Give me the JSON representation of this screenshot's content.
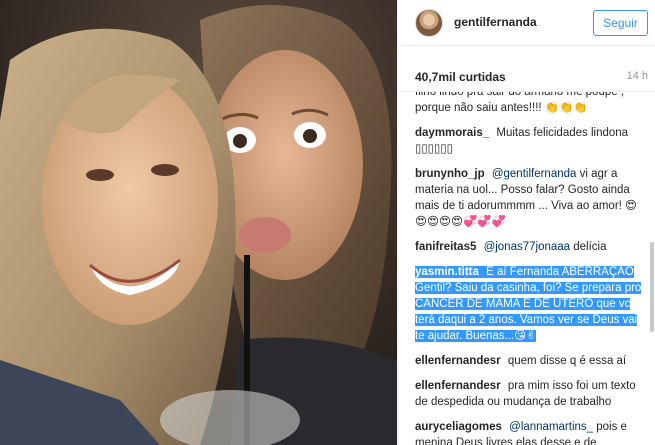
{
  "post": {
    "username": "gentilfernanda",
    "follow_label": "Seguir",
    "likes": "40,7mil curtidas",
    "time": "14 h"
  },
  "comments": [
    {
      "user": "",
      "text": "filho lindo pra sair do armário me poupe , porque não saiu antes!!!! 👏👏👏"
    },
    {
      "user": "daymmorais_",
      "text": "Muitas felicidades lindona ▯▯▯▯▯▯"
    },
    {
      "user": "brunynho_jp",
      "mention": "@gentilfernanda",
      "text": "vi agr a materia na uol... Posso falar? Gosto ainda mais de ti adorummmm ... Viva ao amor! 😍😍😍😍😍💞💞💞"
    },
    {
      "user": "fanifreitas5",
      "mention": "@jonas77jonaaa",
      "text": "delícia"
    },
    {
      "user": "yasmin.titta",
      "text": "E aí Fernanda ABERRAÇÃO Gentil? Saiu da casinha, foi? Se prepara pro CÂNCER DE MAMA E DE ÚTERO que vc terá daqui a 2 anos. Vamos ver se Deus vai te ajudar. Buenas...😘✌"
    },
    {
      "user": "ellenfernandesr",
      "text": "quem disse q é essa aí"
    },
    {
      "user": "ellenfernandesr",
      "text": "pra mim isso foi um texto de despedida ou mudança de trabalho"
    },
    {
      "user": "auryceliagomes",
      "mention": "@lannamartins_",
      "text": "pois e menina Deus livres elas desse e de"
    }
  ]
}
